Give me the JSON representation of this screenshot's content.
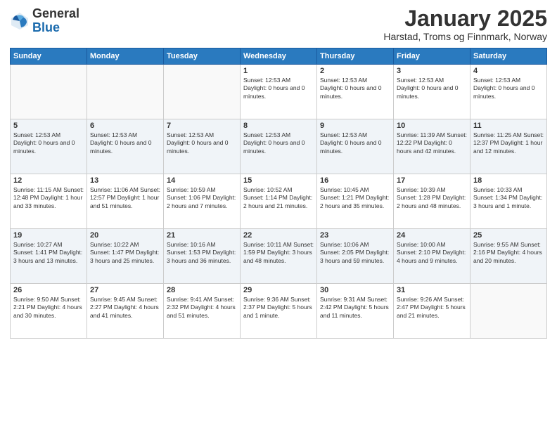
{
  "logo": {
    "general": "General",
    "blue": "Blue"
  },
  "title": "January 2025",
  "location": "Harstad, Troms og Finnmark, Norway",
  "days_header": [
    "Sunday",
    "Monday",
    "Tuesday",
    "Wednesday",
    "Thursday",
    "Friday",
    "Saturday"
  ],
  "weeks": [
    [
      {
        "day": "",
        "info": ""
      },
      {
        "day": "",
        "info": ""
      },
      {
        "day": "",
        "info": ""
      },
      {
        "day": "1",
        "info": "Sunset: 12:53 AM\nDaylight: 0 hours and 0 minutes."
      },
      {
        "day": "2",
        "info": "Sunset: 12:53 AM\nDaylight: 0 hours and 0 minutes."
      },
      {
        "day": "3",
        "info": "Sunset: 12:53 AM\nDaylight: 0 hours and 0 minutes."
      },
      {
        "day": "4",
        "info": "Sunset: 12:53 AM\nDaylight: 0 hours and 0 minutes."
      }
    ],
    [
      {
        "day": "5",
        "info": "Sunset: 12:53 AM\nDaylight: 0 hours and 0 minutes."
      },
      {
        "day": "6",
        "info": "Sunset: 12:53 AM\nDaylight: 0 hours and 0 minutes."
      },
      {
        "day": "7",
        "info": "Sunset: 12:53 AM\nDaylight: 0 hours and 0 minutes."
      },
      {
        "day": "8",
        "info": "Sunset: 12:53 AM\nDaylight: 0 hours and 0 minutes."
      },
      {
        "day": "9",
        "info": "Sunset: 12:53 AM\nDaylight: 0 hours and 0 minutes."
      },
      {
        "day": "10",
        "info": "Sunrise: 11:39 AM\nSunset: 12:22 PM\nDaylight: 0 hours and 42 minutes."
      },
      {
        "day": "11",
        "info": "Sunrise: 11:25 AM\nSunset: 12:37 PM\nDaylight: 1 hour and 12 minutes."
      }
    ],
    [
      {
        "day": "12",
        "info": "Sunrise: 11:15 AM\nSunset: 12:48 PM\nDaylight: 1 hour and 33 minutes."
      },
      {
        "day": "13",
        "info": "Sunrise: 11:06 AM\nSunset: 12:57 PM\nDaylight: 1 hour and 51 minutes."
      },
      {
        "day": "14",
        "info": "Sunrise: 10:59 AM\nSunset: 1:06 PM\nDaylight: 2 hours and 7 minutes."
      },
      {
        "day": "15",
        "info": "Sunrise: 10:52 AM\nSunset: 1:14 PM\nDaylight: 2 hours and 21 minutes."
      },
      {
        "day": "16",
        "info": "Sunrise: 10:45 AM\nSunset: 1:21 PM\nDaylight: 2 hours and 35 minutes."
      },
      {
        "day": "17",
        "info": "Sunrise: 10:39 AM\nSunset: 1:28 PM\nDaylight: 2 hours and 48 minutes."
      },
      {
        "day": "18",
        "info": "Sunrise: 10:33 AM\nSunset: 1:34 PM\nDaylight: 3 hours and 1 minute."
      }
    ],
    [
      {
        "day": "19",
        "info": "Sunrise: 10:27 AM\nSunset: 1:41 PM\nDaylight: 3 hours and 13 minutes."
      },
      {
        "day": "20",
        "info": "Sunrise: 10:22 AM\nSunset: 1:47 PM\nDaylight: 3 hours and 25 minutes."
      },
      {
        "day": "21",
        "info": "Sunrise: 10:16 AM\nSunset: 1:53 PM\nDaylight: 3 hours and 36 minutes."
      },
      {
        "day": "22",
        "info": "Sunrise: 10:11 AM\nSunset: 1:59 PM\nDaylight: 3 hours and 48 minutes."
      },
      {
        "day": "23",
        "info": "Sunrise: 10:06 AM\nSunset: 2:05 PM\nDaylight: 3 hours and 59 minutes."
      },
      {
        "day": "24",
        "info": "Sunrise: 10:00 AM\nSunset: 2:10 PM\nDaylight: 4 hours and 9 minutes."
      },
      {
        "day": "25",
        "info": "Sunrise: 9:55 AM\nSunset: 2:16 PM\nDaylight: 4 hours and 20 minutes."
      }
    ],
    [
      {
        "day": "26",
        "info": "Sunrise: 9:50 AM\nSunset: 2:21 PM\nDaylight: 4 hours and 30 minutes."
      },
      {
        "day": "27",
        "info": "Sunrise: 9:45 AM\nSunset: 2:27 PM\nDaylight: 4 hours and 41 minutes."
      },
      {
        "day": "28",
        "info": "Sunrise: 9:41 AM\nSunset: 2:32 PM\nDaylight: 4 hours and 51 minutes."
      },
      {
        "day": "29",
        "info": "Sunrise: 9:36 AM\nSunset: 2:37 PM\nDaylight: 5 hours and 1 minute."
      },
      {
        "day": "30",
        "info": "Sunrise: 9:31 AM\nSunset: 2:42 PM\nDaylight: 5 hours and 11 minutes."
      },
      {
        "day": "31",
        "info": "Sunrise: 9:26 AM\nSunset: 2:47 PM\nDaylight: 5 hours and 21 minutes."
      },
      {
        "day": "",
        "info": ""
      }
    ]
  ]
}
